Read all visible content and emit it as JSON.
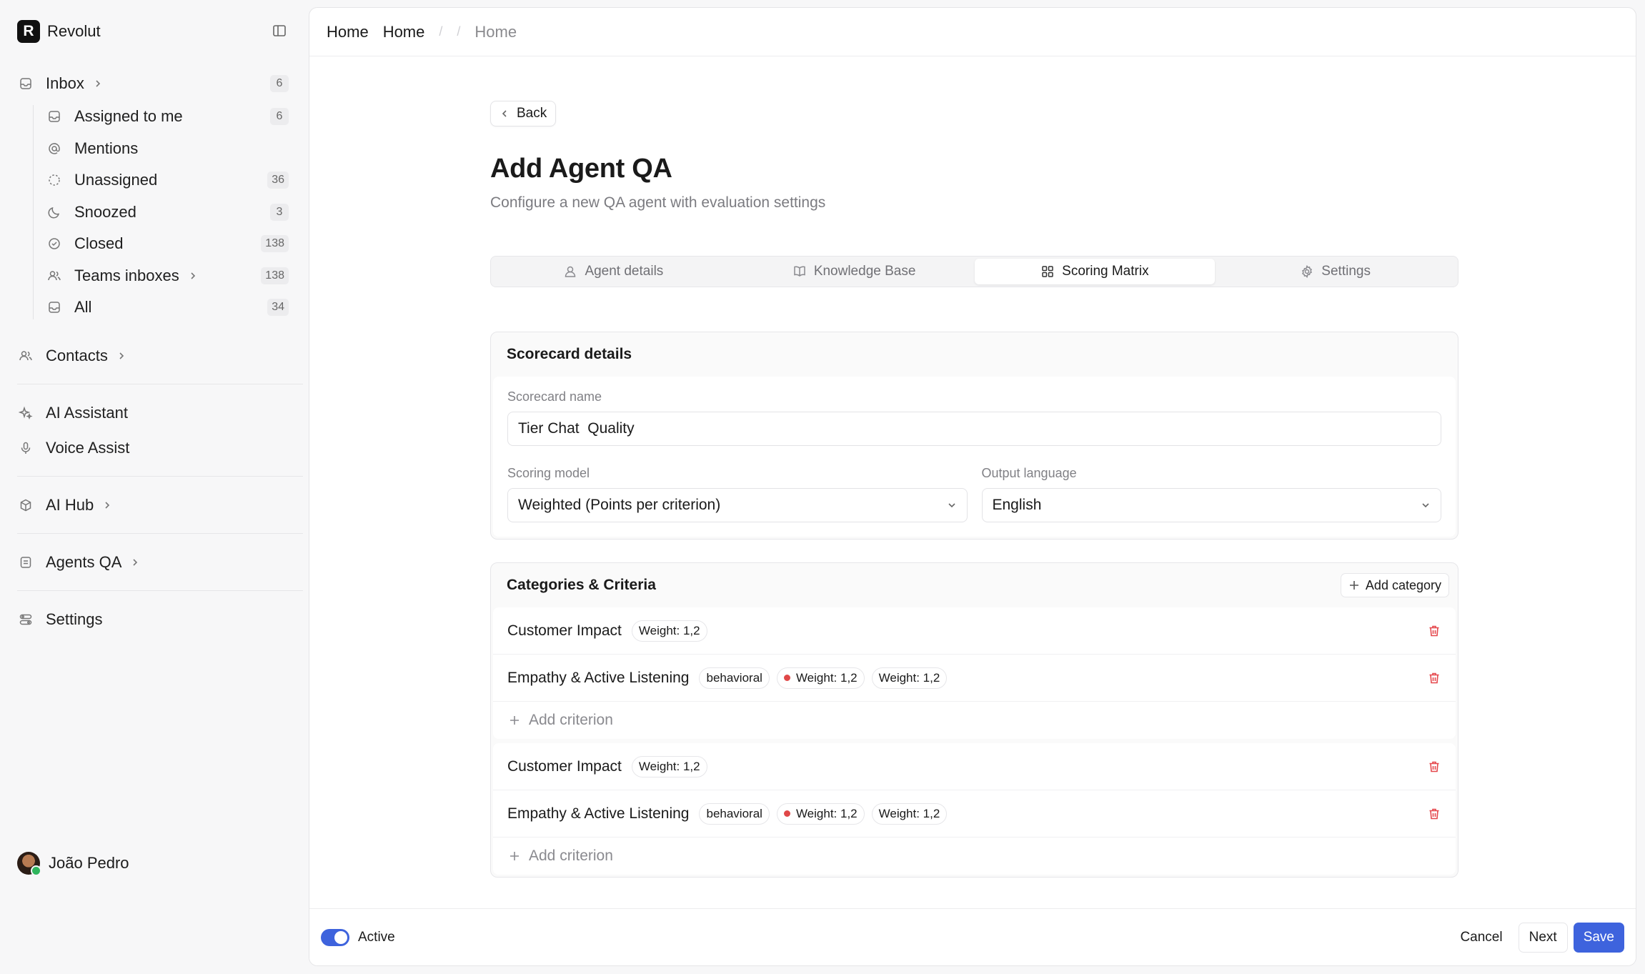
{
  "brand": {
    "logo_letter": "R",
    "name": "Revolut"
  },
  "sidebar": {
    "inbox": {
      "label": "Inbox",
      "count": "6"
    },
    "inbox_items": [
      {
        "label": "Assigned to me",
        "count": "6",
        "icon": "inbox-icon"
      },
      {
        "label": "Mentions",
        "count": "",
        "icon": "at-icon"
      },
      {
        "label": "Unassigned",
        "count": "36",
        "icon": "dashed-circle-icon"
      },
      {
        "label": "Snoozed",
        "count": "3",
        "icon": "moon-icon"
      },
      {
        "label": "Closed",
        "count": "138",
        "icon": "check-circle-icon"
      },
      {
        "label": "Teams inboxes",
        "count": "138",
        "icon": "users-icon"
      },
      {
        "label": "All",
        "count": "34",
        "icon": "inbox-icon"
      }
    ],
    "contacts": "Contacts",
    "ai_assistant": "AI Assistant",
    "voice_assist": "Voice Assist",
    "ai_hub": "AI Hub",
    "agents_qa": "Agents QA",
    "settings": "Settings",
    "user_name": "João Pedro"
  },
  "breadcrumb": [
    "Home",
    "Home",
    "Home"
  ],
  "page": {
    "back_label": "Back",
    "title": "Add Agent QA",
    "subtitle": "Configure a new QA agent with evaluation settings"
  },
  "tabs": [
    {
      "label": "Agent details",
      "icon": "user-icon",
      "active": false
    },
    {
      "label": "Knowledge Base",
      "icon": "book-icon",
      "active": false
    },
    {
      "label": "Scoring Matrix",
      "icon": "grid-icon",
      "active": true
    },
    {
      "label": "Settings",
      "icon": "gear-icon",
      "active": false
    }
  ],
  "scorecard": {
    "heading": "Scorecard details",
    "name_label": "Scorecard name",
    "name_value": "Tier Chat  Quality",
    "model_label": "Scoring model",
    "model_value": "Weighted (Points per criterion)",
    "language_label": "Output language",
    "language_value": "English"
  },
  "categories": {
    "heading": "Categories & Criteria",
    "add_category": "Add category",
    "add_criterion": "Add criterion",
    "blocks": [
      {
        "category": {
          "name": "Customer Impact",
          "weight": "Weight: 1,2"
        },
        "criterion": {
          "name": "Empathy & Active Listening",
          "type": "behavioral",
          "weight_a": "Weight: 1,2",
          "weight_b": "Weight: 1,2"
        }
      },
      {
        "category": {
          "name": "Customer Impact",
          "weight": "Weight: 1,2"
        },
        "criterion": {
          "name": "Empathy & Active Listening",
          "type": "behavioral",
          "weight_a": "Weight: 1,2",
          "weight_b": "Weight: 1,2"
        }
      }
    ]
  },
  "footer": {
    "active_label": "Active",
    "cancel": "Cancel",
    "next": "Next",
    "save": "Save"
  },
  "colors": {
    "accent": "#3e63dd",
    "danger": "#e5484d"
  }
}
